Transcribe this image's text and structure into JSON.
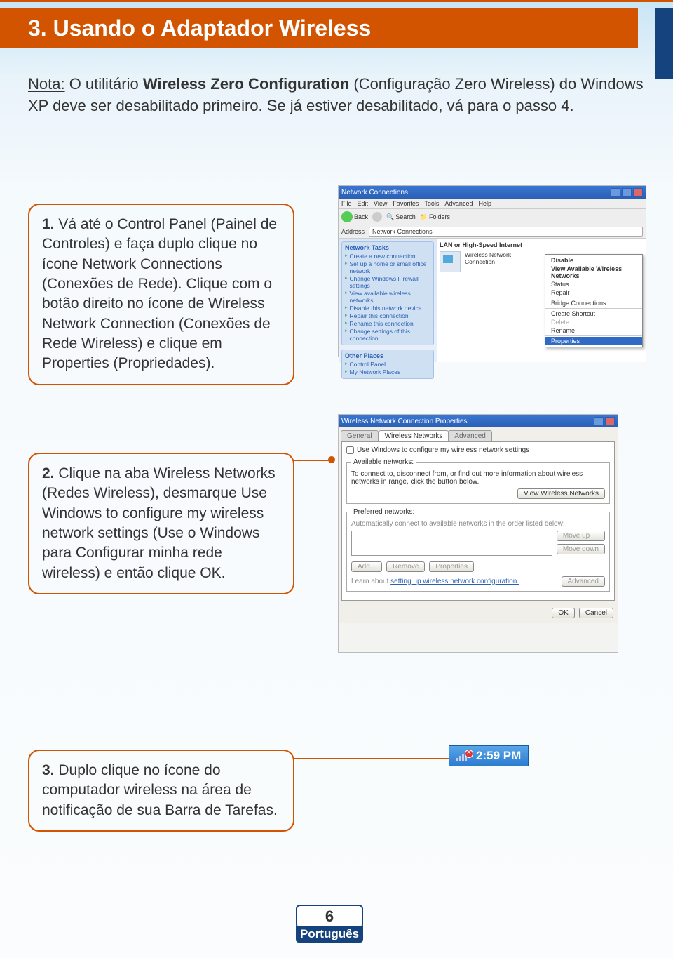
{
  "title": "3. Usando o Adaptador Wireless",
  "intro": {
    "prefix": "Nota:",
    "body_before": " O utilitário ",
    "wzc": "Wireless Zero Configuration",
    "body_mid": " (Configuração Zero Wireless) do Windows XP deve ser desabilitado primeiro. Se já estiver desabilitado, vá para o passo 4."
  },
  "steps": [
    {
      "num": "1.",
      "text": " Vá até o Control Panel (Painel de Controles) e faça duplo clique no ícone Network Connections (Conexões de Rede). Clique com o botão direito no ícone de Wireless Network Connection (Conexões de Rede Wireless) e clique em Properties (Propriedades)."
    },
    {
      "num": "2.",
      "text": " Clique na aba Wireless Networks (Redes Wireless), desmarque Use Windows to configure my wireless network settings (Use o Windows para Configurar minha rede wireless) e então clique OK."
    },
    {
      "num": "3.",
      "text": " Duplo clique no ícone do computador wireless na área de notificação de sua Barra de Tarefas."
    }
  ],
  "screenshot1": {
    "title": "Network Connections",
    "menus": [
      "File",
      "Edit",
      "View",
      "Favorites",
      "Tools",
      "Advanced",
      "Help"
    ],
    "toolbar": {
      "back": "Back",
      "search": "Search",
      "folders": "Folders"
    },
    "address_label": "Address",
    "address_value": "Network Connections",
    "tasks_hdr": "Network Tasks",
    "tasks": [
      "Create a new connection",
      "Set up a home or small office network",
      "Change Windows Firewall settings",
      "View available wireless networks",
      "Disable this network device",
      "Repair this connection",
      "Rename this connection",
      "Change settings of this connection"
    ],
    "other_hdr": "Other Places",
    "other": [
      "Control Panel",
      "My Network Places"
    ],
    "group": "LAN or High-Speed Internet",
    "icon_label": "Wireless Network Connection",
    "context": [
      "Disable",
      "View Available Wireless Networks",
      "Status",
      "Repair",
      "Bridge Connections",
      "Create Shortcut",
      "Delete",
      "Rename",
      "Properties"
    ]
  },
  "screenshot2": {
    "title": "Wireless Network Connection Properties",
    "tabs": [
      "General",
      "Wireless Networks",
      "Advanced"
    ],
    "checkbox": "Use Windows to configure my wireless network settings",
    "avail_hdr": "Available networks:",
    "avail_text": "To connect to, disconnect from, or find out more information about wireless networks in range, click the button below.",
    "view_btn": "View Wireless Networks",
    "pref_hdr": "Preferred networks:",
    "pref_text": "Automatically connect to available networks in the order listed below:",
    "moveup": "Move up",
    "movedown": "Move down",
    "add": "Add...",
    "remove": "Remove",
    "props": "Properties",
    "learn": "Learn about ",
    "learn_link": "setting up wireless network configuration.",
    "adv": "Advanced",
    "ok": "OK",
    "cancel": "Cancel"
  },
  "tray": {
    "time": "2:59 PM"
  },
  "footer": {
    "page": "6",
    "lang": "Português"
  }
}
